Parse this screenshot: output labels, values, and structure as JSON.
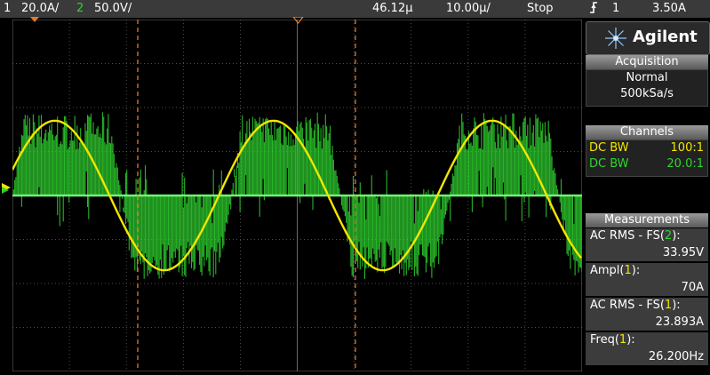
{
  "topbar": {
    "ch1_num": "1",
    "ch1_scale": "20.0A/",
    "ch2_num": "2",
    "ch2_scale": "50.0V/",
    "time_delay": "46.12µ",
    "time_scale": "10.00µ/",
    "run_state": "Stop",
    "trigger_channel": "1",
    "trigger_level": "3.50A"
  },
  "brand": {
    "name": "Agilent"
  },
  "acquisition": {
    "title": "Acquisition",
    "mode": "Normal",
    "rate": "500kSa/s"
  },
  "channels": {
    "title": "Channels",
    "items": [
      {
        "coupling": "DC BW",
        "probe": "100:1",
        "color": "#f2e600"
      },
      {
        "coupling": "DC BW",
        "probe": "20.0:1",
        "color": "#2fd52f"
      }
    ]
  },
  "measurements": {
    "title": "Measurements",
    "items": [
      {
        "label": "AC RMS - FS(",
        "src": "2",
        "close": "):",
        "value": "33.95V"
      },
      {
        "label": "Ampl(",
        "src": "1",
        "close": "):",
        "value": "70A"
      },
      {
        "label": "AC RMS - FS(",
        "src": "1",
        "close": "):",
        "value": "23.893A"
      },
      {
        "label": "Freq(",
        "src": "1",
        "close": "):",
        "value": "26.200Hz"
      }
    ]
  },
  "colors": {
    "ch1": "#f2e600",
    "ch2": "#2fd52f",
    "cursor": "#e07a2a",
    "grid": "#6a6a6a"
  },
  "waveforms": {
    "current_frequency_hz": 26.2,
    "current_amplitude_divisions": 1.7,
    "voltage_band_divisions": 1.9
  }
}
